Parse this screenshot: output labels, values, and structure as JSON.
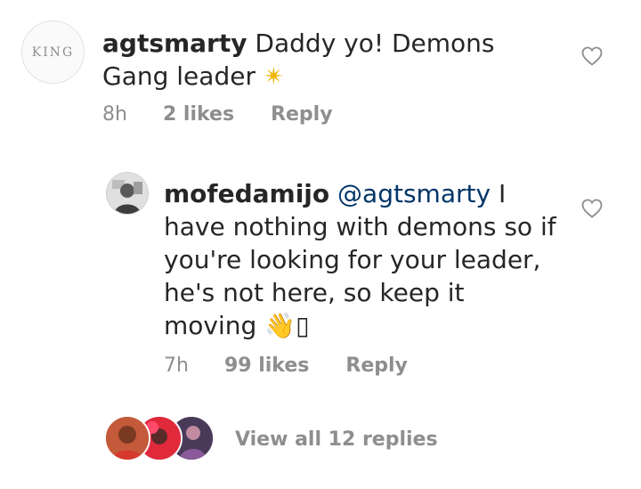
{
  "comment": {
    "avatar_text": "KING",
    "username": "agtsmarty",
    "text": "Daddy yo! Demons Gang leader",
    "emoji": "✴",
    "time": "8h",
    "likes": "2 likes",
    "reply_label": "Reply"
  },
  "reply": {
    "username": "mofedamijo",
    "mention": "@agtsmarty",
    "text": "I have nothing with demons so if you're looking for your leader, he's not here, so keep it moving",
    "emoji": "👋",
    "trailing_glyph": "▯",
    "time": "7h",
    "likes": "99 likes",
    "reply_label": "Reply"
  },
  "replies": {
    "view_all_label": "View all 12 replies"
  },
  "colors": {
    "text": "#262626",
    "muted": "#8e8e8e",
    "mention": "#003569"
  },
  "icons": [
    "heart-icon"
  ]
}
